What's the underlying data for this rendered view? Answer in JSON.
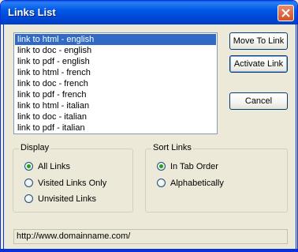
{
  "window": {
    "title": "Links List"
  },
  "links": {
    "items": [
      "link to html - english",
      "link to doc - english",
      "link to pdf - english",
      "link to html - french",
      "link to doc - french",
      "link to pdf - french",
      "link to html - italian",
      "link to doc - italian",
      "link to pdf - italian"
    ],
    "selected": "link to html - english"
  },
  "buttons": {
    "move_to_link": "Move To Link",
    "activate_link": "Activate Link",
    "cancel": "Cancel"
  },
  "display": {
    "legend": "Display",
    "options": [
      "All Links",
      "Visited Links Only",
      "Unvisited Links"
    ],
    "selected": "All Links"
  },
  "sort": {
    "legend": "Sort Links",
    "options": [
      "In Tab Order",
      "Alphabetically"
    ],
    "selected": "In Tab Order"
  },
  "status": {
    "url": "http://www.domainname.com/"
  },
  "colors": {
    "titlebar": "#0058e6",
    "selection": "#316ac5",
    "close": "#d2512a",
    "radio_dot": "#21a121"
  }
}
